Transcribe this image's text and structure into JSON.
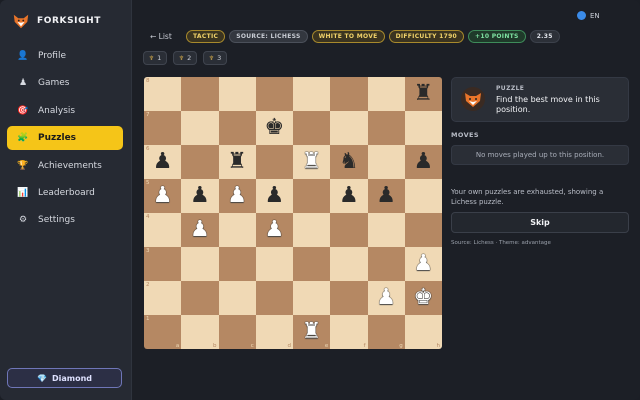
{
  "app": {
    "name": "FORKSIGHT",
    "lang": "EN"
  },
  "sidebar": {
    "items": [
      {
        "label": "Profile",
        "icon": "user-icon",
        "glyph": "👤",
        "active": false
      },
      {
        "label": "Games",
        "icon": "pawn-icon",
        "glyph": "♟",
        "active": false
      },
      {
        "label": "Analysis",
        "icon": "target-icon",
        "glyph": "🎯",
        "active": false
      },
      {
        "label": "Puzzles",
        "icon": "puzzle-icon",
        "glyph": "🧩",
        "active": true
      },
      {
        "label": "Achievements",
        "icon": "trophy-icon",
        "glyph": "🏆",
        "active": false
      },
      {
        "label": "Leaderboard",
        "icon": "chart-icon",
        "glyph": "📊",
        "active": false
      },
      {
        "label": "Settings",
        "icon": "gear-icon",
        "glyph": "⚙",
        "active": false
      }
    ],
    "plan": "Diamond"
  },
  "header": {
    "back_label": "← List",
    "chips": [
      {
        "label": "TACTIC",
        "style": "gold"
      },
      {
        "label": "SOURCE: LICHESS",
        "style": "gray"
      },
      {
        "label": "WHITE TO MOVE",
        "style": "gold"
      },
      {
        "label": "DIFFICULTY 1790",
        "style": "gold"
      },
      {
        "label": "+10 POINTS",
        "style": "green"
      },
      {
        "label": "2.35",
        "style": "dark"
      }
    ],
    "hints": [
      "1",
      "2",
      "3"
    ]
  },
  "board": {
    "ranks": [
      "8",
      "7",
      "6",
      "5",
      "4",
      "3",
      "2",
      "1"
    ],
    "files": [
      "a",
      "b",
      "c",
      "d",
      "e",
      "f",
      "g",
      "h"
    ],
    "rows": [
      [
        "",
        "",
        "",
        "",
        "",
        "",
        "",
        "bR"
      ],
      [
        "",
        "",
        "",
        "bK",
        "",
        "",
        "",
        ""
      ],
      [
        "bP",
        "",
        "bR",
        "",
        "wR",
        "bN",
        "",
        "bP"
      ],
      [
        "wP",
        "bP",
        "wP",
        "bP",
        "",
        "bP",
        "bP",
        ""
      ],
      [
        "",
        "wP",
        "",
        "wP",
        "",
        "",
        "",
        ""
      ],
      [
        "",
        "",
        "",
        "",
        "",
        "",
        "",
        "wP"
      ],
      [
        "",
        "",
        "",
        "",
        "",
        "",
        "wP",
        "wK"
      ],
      [
        "",
        "",
        "",
        "",
        "wR",
        "",
        "",
        ""
      ]
    ]
  },
  "panel": {
    "label": "PUZZLE",
    "prompt": "Find the best move in this position.",
    "moves_label": "MOVES",
    "moves_empty": "No moves played up to this position.",
    "exhausted": "Your own puzzles are exhausted, showing a Lichess puzzle.",
    "skip_label": "Skip",
    "source": "Source: Lichess · Theme: advantage"
  }
}
